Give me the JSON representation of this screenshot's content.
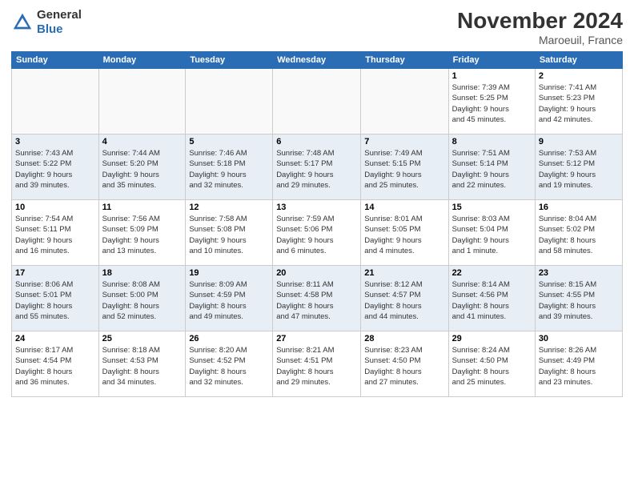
{
  "header": {
    "logo_line1": "General",
    "logo_line2": "Blue",
    "month": "November 2024",
    "location": "Maroeuil, France"
  },
  "weekdays": [
    "Sunday",
    "Monday",
    "Tuesday",
    "Wednesday",
    "Thursday",
    "Friday",
    "Saturday"
  ],
  "weeks": [
    [
      {
        "day": "",
        "info": ""
      },
      {
        "day": "",
        "info": ""
      },
      {
        "day": "",
        "info": ""
      },
      {
        "day": "",
        "info": ""
      },
      {
        "day": "",
        "info": ""
      },
      {
        "day": "1",
        "info": "Sunrise: 7:39 AM\nSunset: 5:25 PM\nDaylight: 9 hours\nand 45 minutes."
      },
      {
        "day": "2",
        "info": "Sunrise: 7:41 AM\nSunset: 5:23 PM\nDaylight: 9 hours\nand 42 minutes."
      }
    ],
    [
      {
        "day": "3",
        "info": "Sunrise: 7:43 AM\nSunset: 5:22 PM\nDaylight: 9 hours\nand 39 minutes."
      },
      {
        "day": "4",
        "info": "Sunrise: 7:44 AM\nSunset: 5:20 PM\nDaylight: 9 hours\nand 35 minutes."
      },
      {
        "day": "5",
        "info": "Sunrise: 7:46 AM\nSunset: 5:18 PM\nDaylight: 9 hours\nand 32 minutes."
      },
      {
        "day": "6",
        "info": "Sunrise: 7:48 AM\nSunset: 5:17 PM\nDaylight: 9 hours\nand 29 minutes."
      },
      {
        "day": "7",
        "info": "Sunrise: 7:49 AM\nSunset: 5:15 PM\nDaylight: 9 hours\nand 25 minutes."
      },
      {
        "day": "8",
        "info": "Sunrise: 7:51 AM\nSunset: 5:14 PM\nDaylight: 9 hours\nand 22 minutes."
      },
      {
        "day": "9",
        "info": "Sunrise: 7:53 AM\nSunset: 5:12 PM\nDaylight: 9 hours\nand 19 minutes."
      }
    ],
    [
      {
        "day": "10",
        "info": "Sunrise: 7:54 AM\nSunset: 5:11 PM\nDaylight: 9 hours\nand 16 minutes."
      },
      {
        "day": "11",
        "info": "Sunrise: 7:56 AM\nSunset: 5:09 PM\nDaylight: 9 hours\nand 13 minutes."
      },
      {
        "day": "12",
        "info": "Sunrise: 7:58 AM\nSunset: 5:08 PM\nDaylight: 9 hours\nand 10 minutes."
      },
      {
        "day": "13",
        "info": "Sunrise: 7:59 AM\nSunset: 5:06 PM\nDaylight: 9 hours\nand 6 minutes."
      },
      {
        "day": "14",
        "info": "Sunrise: 8:01 AM\nSunset: 5:05 PM\nDaylight: 9 hours\nand 4 minutes."
      },
      {
        "day": "15",
        "info": "Sunrise: 8:03 AM\nSunset: 5:04 PM\nDaylight: 9 hours\nand 1 minute."
      },
      {
        "day": "16",
        "info": "Sunrise: 8:04 AM\nSunset: 5:02 PM\nDaylight: 8 hours\nand 58 minutes."
      }
    ],
    [
      {
        "day": "17",
        "info": "Sunrise: 8:06 AM\nSunset: 5:01 PM\nDaylight: 8 hours\nand 55 minutes."
      },
      {
        "day": "18",
        "info": "Sunrise: 8:08 AM\nSunset: 5:00 PM\nDaylight: 8 hours\nand 52 minutes."
      },
      {
        "day": "19",
        "info": "Sunrise: 8:09 AM\nSunset: 4:59 PM\nDaylight: 8 hours\nand 49 minutes."
      },
      {
        "day": "20",
        "info": "Sunrise: 8:11 AM\nSunset: 4:58 PM\nDaylight: 8 hours\nand 47 minutes."
      },
      {
        "day": "21",
        "info": "Sunrise: 8:12 AM\nSunset: 4:57 PM\nDaylight: 8 hours\nand 44 minutes."
      },
      {
        "day": "22",
        "info": "Sunrise: 8:14 AM\nSunset: 4:56 PM\nDaylight: 8 hours\nand 41 minutes."
      },
      {
        "day": "23",
        "info": "Sunrise: 8:15 AM\nSunset: 4:55 PM\nDaylight: 8 hours\nand 39 minutes."
      }
    ],
    [
      {
        "day": "24",
        "info": "Sunrise: 8:17 AM\nSunset: 4:54 PM\nDaylight: 8 hours\nand 36 minutes."
      },
      {
        "day": "25",
        "info": "Sunrise: 8:18 AM\nSunset: 4:53 PM\nDaylight: 8 hours\nand 34 minutes."
      },
      {
        "day": "26",
        "info": "Sunrise: 8:20 AM\nSunset: 4:52 PM\nDaylight: 8 hours\nand 32 minutes."
      },
      {
        "day": "27",
        "info": "Sunrise: 8:21 AM\nSunset: 4:51 PM\nDaylight: 8 hours\nand 29 minutes."
      },
      {
        "day": "28",
        "info": "Sunrise: 8:23 AM\nSunset: 4:50 PM\nDaylight: 8 hours\nand 27 minutes."
      },
      {
        "day": "29",
        "info": "Sunrise: 8:24 AM\nSunset: 4:50 PM\nDaylight: 8 hours\nand 25 minutes."
      },
      {
        "day": "30",
        "info": "Sunrise: 8:26 AM\nSunset: 4:49 PM\nDaylight: 8 hours\nand 23 minutes."
      }
    ]
  ]
}
